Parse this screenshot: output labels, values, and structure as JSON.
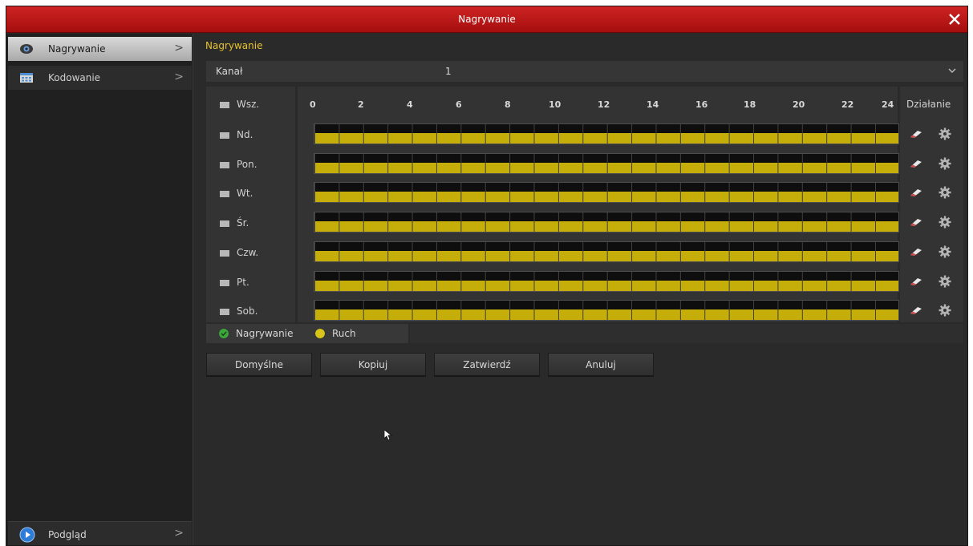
{
  "window": {
    "title": "Nagrywanie"
  },
  "sidebar": {
    "items": [
      {
        "label": "Nagrywanie",
        "icon": "camera-icon",
        "chevron": ">"
      },
      {
        "label": "Kodowanie",
        "icon": "encoding-grid-icon",
        "chevron": ">"
      }
    ],
    "footer": {
      "label": "Podgląd",
      "icon": "play-circle-icon",
      "chevron": ">"
    }
  },
  "main": {
    "section_title": "Nagrywanie",
    "channel": {
      "label": "Kanał",
      "value": "1"
    },
    "schedule": {
      "all_label": "Wsz.",
      "hours": [
        "0",
        "2",
        "4",
        "6",
        "8",
        "10",
        "12",
        "14",
        "16",
        "18",
        "20",
        "22",
        "24"
      ],
      "action_header": "Działanie",
      "days": [
        {
          "label": "Nd.",
          "recording_fraction": 1.0
        },
        {
          "label": "Pon.",
          "recording_fraction": 1.0
        },
        {
          "label": "Wt.",
          "recording_fraction": 1.0
        },
        {
          "label": "Śr.",
          "recording_fraction": 1.0
        },
        {
          "label": "Czw.",
          "recording_fraction": 1.0
        },
        {
          "label": "Pt.",
          "recording_fraction": 1.0
        },
        {
          "label": "Sob.",
          "recording_fraction": 1.0
        }
      ]
    },
    "legend": [
      {
        "label": "Nagrywanie",
        "color": "#3aa83a"
      },
      {
        "label": "Ruch",
        "color": "#d8c41a"
      }
    ],
    "buttons": {
      "default": "Domyślne",
      "copy": "Kopiuj",
      "apply": "Zatwierdź",
      "cancel": "Anuluj"
    }
  },
  "colors": {
    "accent_title": "#e6c32c",
    "titlebar": "#c01818",
    "schedule_fill": "#c6ae0a"
  }
}
